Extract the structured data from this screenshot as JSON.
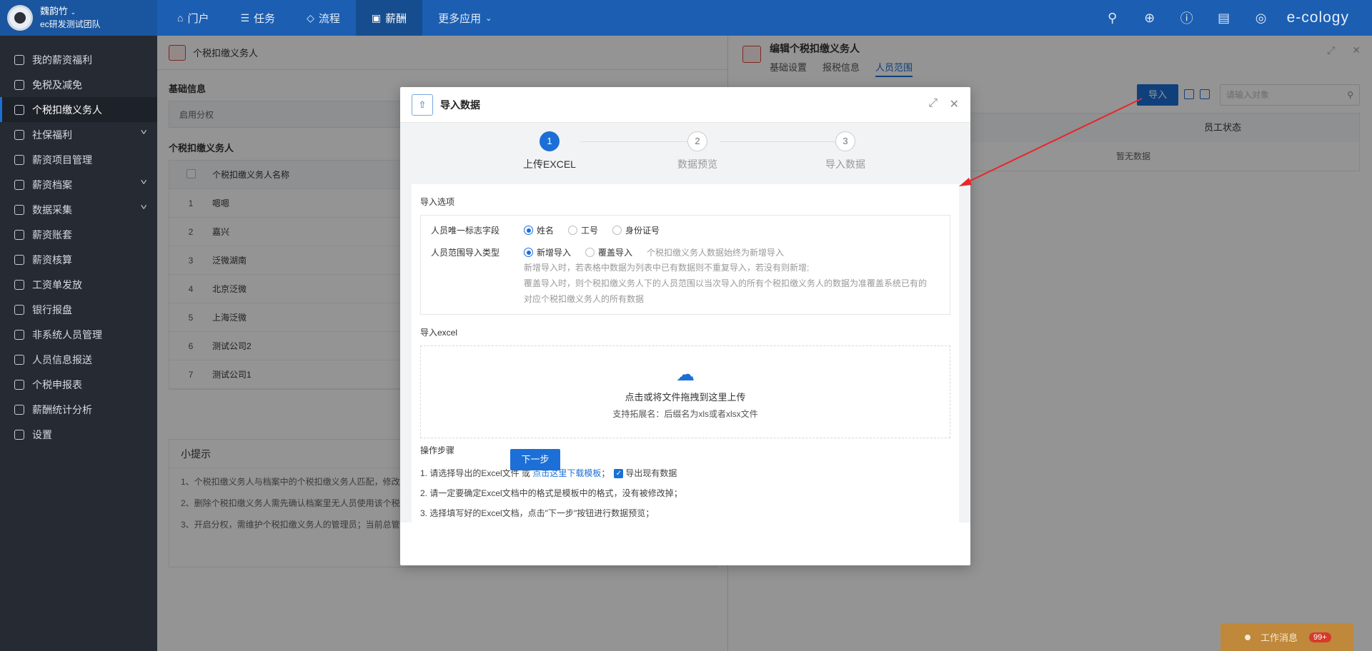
{
  "user": {
    "name": "魏韵竹",
    "team": "ec研发测试团队"
  },
  "nav": [
    {
      "label": "门户",
      "icon": "home-icon"
    },
    {
      "label": "任务",
      "icon": "list-icon"
    },
    {
      "label": "流程",
      "icon": "layers-icon"
    },
    {
      "label": "薪酬",
      "icon": "money-icon",
      "active": true
    },
    {
      "label": "更多应用",
      "icon": "chevron-down-icon"
    }
  ],
  "brand": "e-cology",
  "sidebar": [
    {
      "label": "我的薪资福利"
    },
    {
      "label": "免税及减免"
    },
    {
      "label": "个税扣缴义务人",
      "active": true
    },
    {
      "label": "社保福利",
      "expand": true
    },
    {
      "label": "薪资项目管理"
    },
    {
      "label": "薪资档案",
      "expand": true
    },
    {
      "label": "数据采集",
      "expand": true
    },
    {
      "label": "薪资账套"
    },
    {
      "label": "薪资核算"
    },
    {
      "label": "工资单发放"
    },
    {
      "label": "银行报盘"
    },
    {
      "label": "非系统人员管理"
    },
    {
      "label": "人员信息报送"
    },
    {
      "label": "个税申报表"
    },
    {
      "label": "薪酬统计分析"
    },
    {
      "label": "设置"
    }
  ],
  "left_panel": {
    "title": "个税扣缴义务人",
    "basic_label": "基础信息",
    "field": "启用分权",
    "table_label": "个税扣缴义务人",
    "col_name": "个税扣缴义务人名称",
    "rows": [
      {
        "n": "1",
        "name": "嗯嗯"
      },
      {
        "n": "2",
        "name": "嘉兴"
      },
      {
        "n": "3",
        "name": "泛微湖南"
      },
      {
        "n": "4",
        "name": "北京泛微"
      },
      {
        "n": "5",
        "name": "上海泛微"
      },
      {
        "n": "6",
        "name": "测试公司2"
      },
      {
        "n": "7",
        "name": "测试公司1"
      }
    ],
    "tips_title": "小提示",
    "tips": [
      "1、个税扣缴义务人与档案中的个税扣缴义务人匹配，修改",
      "2、删除个税扣缴义务人需先确认档案里无人员使用该个税",
      "3、开启分权，需维护个税扣缴义务人的管理员；当前总管"
    ]
  },
  "right_panel": {
    "title": "编辑个税扣缴义务人",
    "tabs": [
      "基础设置",
      "报税信息",
      "人员范围"
    ],
    "import_btn": "导入",
    "search_placeholder": "请输入对象",
    "col_status": "员工状态",
    "empty": "暂无数据"
  },
  "modal": {
    "title": "导入数据",
    "steps": [
      {
        "num": "1",
        "label": "上传EXCEL"
      },
      {
        "num": "2",
        "label": "数据预览"
      },
      {
        "num": "3",
        "label": "导入数据"
      }
    ],
    "options_title": "导入选项",
    "unique_label": "人员唯一标志字段",
    "unique_opts": [
      "姓名",
      "工号",
      "身份证号"
    ],
    "type_label": "人员范围导入类型",
    "type_opts": [
      "新增导入",
      "覆盖导入"
    ],
    "type_hint": "个税扣缴义务人数据始终为新增导入",
    "desc1": "新增导入时，若表格中数据为列表中已有数据则不重复导入，若没有则新增;",
    "desc2": "覆盖导入时，则个税扣缴义务人下的人员范围以当次导入的所有个税扣缴义务人的数据为准覆盖系统已有的",
    "desc3": "对应个税扣缴义务人的所有数据",
    "excel_title": "导入excel",
    "upload_main": "点击或将文件拖拽到这里上传",
    "upload_sub": "支持拓展名：后缀名为xls或者xlsx文件",
    "ops_title": "操作步骤",
    "op1_pre": "1. 请选择导出的Excel文件 或 ",
    "op1_link": "点击这里下载模板",
    "op1_sep": "；",
    "op1_cb": "导出现有数据",
    "op2": "2. 请一定要确定Excel文档中的格式是模板中的格式，没有被修改掉；",
    "op3": "3. 选择填写好的Excel文档，点击\"下一步\"按钮进行数据预览；",
    "next": "下一步"
  },
  "notice": {
    "label": "工作消息",
    "badge": "99+"
  },
  "colors": {
    "primary": "#1c6fd6",
    "topbar": "#1c5fb2",
    "sidebar": "#262a33",
    "arrow": "#e8262b"
  }
}
